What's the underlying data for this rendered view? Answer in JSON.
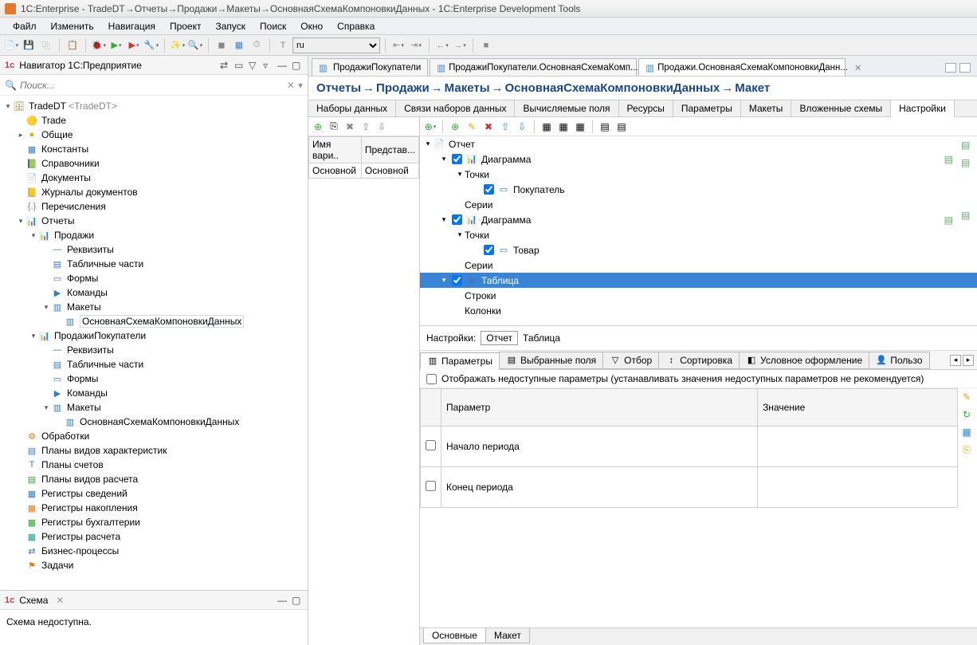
{
  "window": {
    "title": "1C:Enterprise - TradeDT→Отчеты→Продажи→Макеты→ОсновнаяСхемаКомпоновкиДанных - 1C:Enterprise Development Tools"
  },
  "menu": [
    "Файл",
    "Изменить",
    "Навигация",
    "Проект",
    "Запуск",
    "Поиск",
    "Окно",
    "Справка"
  ],
  "toolbar": {
    "language": "ru"
  },
  "navigator": {
    "title": "Навигатор 1C:Предприятие",
    "search_placeholder": "Поиск...",
    "root": "TradeDT",
    "root_suffix": "<TradeDT>",
    "tree": [
      {
        "l": "Trade",
        "i": "🟡",
        "d": 2
      },
      {
        "l": "Общие",
        "i": "●",
        "d": 2,
        "exp": false,
        "c": "ico-yellow"
      },
      {
        "l": "Константы",
        "i": "▦",
        "d": 2,
        "c": "ico-blue"
      },
      {
        "l": "Справочники",
        "i": "📗",
        "d": 2,
        "c": "ico-green"
      },
      {
        "l": "Документы",
        "i": "📄",
        "d": 2,
        "c": "ico-orange"
      },
      {
        "l": "Журналы документов",
        "i": "📒",
        "d": 2,
        "c": "ico-green"
      },
      {
        "l": "Перечисления",
        "i": "{.}",
        "d": 2,
        "c": "ico-gray"
      },
      {
        "l": "Отчеты",
        "i": "📊",
        "d": 2,
        "exp": true,
        "c": "ico-orange"
      },
      {
        "l": "Продажи",
        "i": "📊",
        "d": 3,
        "exp": true,
        "c": "ico-orange"
      },
      {
        "l": "Реквизиты",
        "i": "—",
        "d": 4,
        "c": "ico-blue"
      },
      {
        "l": "Табличные части",
        "i": "▤",
        "d": 4,
        "c": "ico-blue"
      },
      {
        "l": "Формы",
        "i": "▭",
        "d": 4,
        "c": "ico-blue"
      },
      {
        "l": "Команды",
        "i": "▶",
        "d": 4,
        "c": "ico-blue"
      },
      {
        "l": "Макеты",
        "i": "▥",
        "d": 4,
        "exp": true,
        "c": "ico-blue"
      },
      {
        "l": "ОсновнаяСхемаКомпоновкиДанных",
        "i": "▥",
        "d": 5,
        "sel": true,
        "c": "ico-blue"
      },
      {
        "l": "ПродажиПокупатели",
        "i": "📊",
        "d": 3,
        "exp": true,
        "c": "ico-orange"
      },
      {
        "l": "Реквизиты",
        "i": "—",
        "d": 4,
        "c": "ico-blue"
      },
      {
        "l": "Табличные части",
        "i": "▤",
        "d": 4,
        "c": "ico-blue"
      },
      {
        "l": "Формы",
        "i": "▭",
        "d": 4,
        "c": "ico-blue"
      },
      {
        "l": "Команды",
        "i": "▶",
        "d": 4,
        "c": "ico-blue"
      },
      {
        "l": "Макеты",
        "i": "▥",
        "d": 4,
        "exp": true,
        "c": "ico-blue"
      },
      {
        "l": "ОсновнаяСхемаКомпоновкиДанных",
        "i": "▥",
        "d": 5,
        "c": "ico-blue"
      },
      {
        "l": "Обработки",
        "i": "⚙",
        "d": 2,
        "c": "ico-orange"
      },
      {
        "l": "Планы видов характеристик",
        "i": "▤",
        "d": 2,
        "c": "ico-blue"
      },
      {
        "l": "Планы счетов",
        "i": "Т",
        "d": 2,
        "c": "ico-teal"
      },
      {
        "l": "Планы видов расчета",
        "i": "▤",
        "d": 2,
        "c": "ico-green"
      },
      {
        "l": "Регистры сведений",
        "i": "▦",
        "d": 2,
        "c": "ico-blue"
      },
      {
        "l": "Регистры накопления",
        "i": "▦",
        "d": 2,
        "c": "ico-orange"
      },
      {
        "l": "Регистры бухгалтерии",
        "i": "▦",
        "d": 2,
        "c": "ico-green"
      },
      {
        "l": "Регистры расчета",
        "i": "▦",
        "d": 2,
        "c": "ico-teal"
      },
      {
        "l": "Бизнес-процессы",
        "i": "⇄",
        "d": 2,
        "c": "ico-blue"
      },
      {
        "l": "Задачи",
        "i": "⚑",
        "d": 2,
        "c": "ico-orange"
      }
    ]
  },
  "schema": {
    "tab_title": "Схема",
    "body": "Схема недоступна."
  },
  "editor_tabs": [
    {
      "label": "ПродажиПокупатели",
      "active": false
    },
    {
      "label": "ПродажиПокупатели.ОсновнаяСхемаКомп...",
      "active": false
    },
    {
      "label": "Продажи.ОсновнаяСхемаКомпоновкиДанн...",
      "active": true,
      "close": true
    }
  ],
  "breadcrumb": [
    "Отчеты",
    "Продажи",
    "Макеты",
    "ОсновнаяСхемаКомпоновкиДанных",
    "Макет"
  ],
  "inner_tabs": [
    "Наборы данных",
    "Связи наборов данных",
    "Вычисляемые поля",
    "Ресурсы",
    "Параметры",
    "Макеты",
    "Вложенные схемы",
    "Настройки"
  ],
  "inner_active": "Настройки",
  "variants": {
    "cols": [
      "Имя вари..",
      "Представ..."
    ],
    "rows": [
      [
        "Основной",
        "Основной"
      ]
    ]
  },
  "report_tree": [
    {
      "d": 1,
      "tw": "▾",
      "ico": "📄",
      "l": "Отчет",
      "c": "ico-blue"
    },
    {
      "d": 2,
      "tw": "▾",
      "cb": true,
      "ico": "📊",
      "l": "Диаграмма",
      "c": "ico-orange",
      "rico": true
    },
    {
      "d": 3,
      "tw": "▾",
      "l": "Точки"
    },
    {
      "d": 4,
      "cb": true,
      "ico": "▭",
      "l": "Покупатель",
      "c": "ico-blue"
    },
    {
      "d": 3,
      "l": "Серии"
    },
    {
      "d": 2,
      "tw": "▾",
      "cb": true,
      "ico": "📊",
      "l": "Диаграмма",
      "c": "ico-orange",
      "rico": true
    },
    {
      "d": 3,
      "tw": "▾",
      "l": "Точки"
    },
    {
      "d": 4,
      "cb": true,
      "ico": "▭",
      "l": "Товар",
      "c": "ico-blue"
    },
    {
      "d": 3,
      "l": "Серии"
    },
    {
      "d": 2,
      "tw": "▾",
      "cb": true,
      "ico": "▦",
      "l": "Таблица",
      "c": "ico-blue",
      "selected": true
    },
    {
      "d": 3,
      "l": "Строки"
    },
    {
      "d": 3,
      "l": "Колонки"
    }
  ],
  "settings_path": {
    "label": "Настройки:",
    "box": "Отчет",
    "tail": "Таблица"
  },
  "param_tabs": [
    "Параметры",
    "Выбранные поля",
    "Отбор",
    "Сортировка",
    "Условное оформление",
    "Пользо"
  ],
  "param_active": "Параметры",
  "params_checkbox": "Отображать недоступные параметры (устанавливать значения недоступных параметров не рекомендуется)",
  "params_table": {
    "cols": [
      "Параметр",
      "Значение"
    ],
    "rows": [
      [
        "Начало периода",
        ""
      ],
      [
        "Конец периода",
        ""
      ]
    ]
  },
  "bottom_tabs": [
    "Основные",
    "Макет"
  ]
}
